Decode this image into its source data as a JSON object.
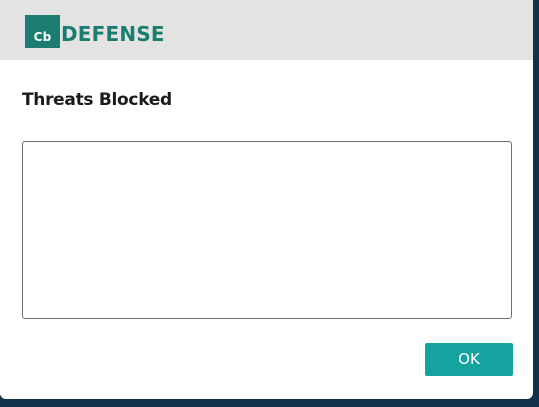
{
  "brand": {
    "mark_text": "Cb",
    "word_text": "DEFENSE",
    "color": "#1a7d70"
  },
  "dialog": {
    "title": "Threats Blocked",
    "threats_list_value": "",
    "ok_label": "OK"
  },
  "colors": {
    "header_bg": "#e3e3e3",
    "button_bg": "#15a3a0",
    "backdrop": "#12324a"
  }
}
